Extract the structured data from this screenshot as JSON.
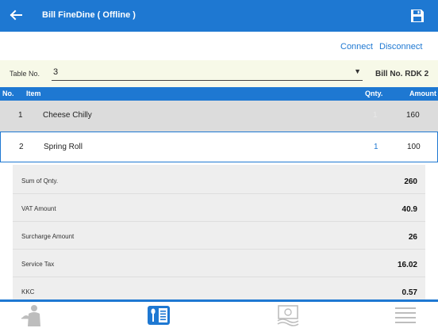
{
  "header": {
    "title": "Bill FineDine ( Offline )",
    "back_icon": "back-arrow-icon",
    "save_icon": "save-icon",
    "background": "#1e78d2"
  },
  "connection": {
    "connect_label": "Connect",
    "disconnect_label": "Disconnect"
  },
  "table_selector": {
    "label": "Table No.",
    "value": "3",
    "bill_no": "Bill No. RDK 2"
  },
  "items_table": {
    "columns": [
      "No.",
      "Item",
      "Qnty.",
      "Amount"
    ],
    "rows": [
      {
        "no": "1",
        "name": "Cheese Chilly",
        "qty": "1",
        "amount": "160"
      },
      {
        "no": "2",
        "name": "Spring Roll",
        "qty": "1",
        "amount": "100"
      }
    ]
  },
  "summary": [
    {
      "label": "Sum of Qnty.",
      "value": "260"
    },
    {
      "label": "VAT Amount",
      "value": "40.9"
    },
    {
      "label": "Surcharge Amount",
      "value": "26"
    },
    {
      "label": "Service Tax",
      "value": "16.02"
    },
    {
      "label": "KKC",
      "value": "0.57"
    }
  ],
  "bottom_nav": [
    {
      "icon": "waiter-icon",
      "active": false
    },
    {
      "icon": "menu-card-icon",
      "active": true
    },
    {
      "icon": "cash-icon",
      "active": false
    },
    {
      "icon": "list-icon",
      "active": false
    }
  ],
  "colors": {
    "accent": "#1e78d2",
    "selected_row": "#dcdcdc",
    "table_row_bg": "#f7f9e8"
  }
}
